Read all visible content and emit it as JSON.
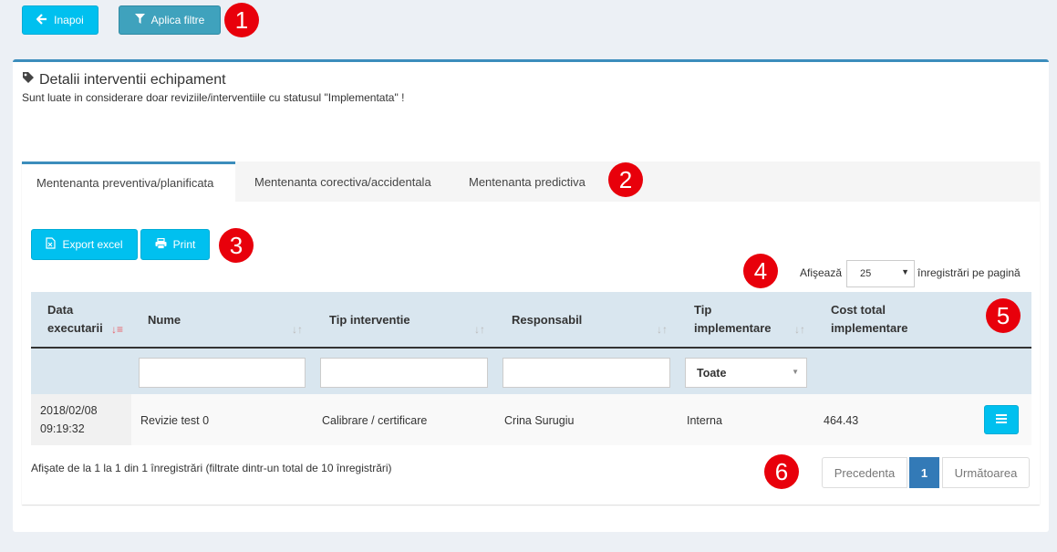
{
  "toolbar": {
    "back_label": "Inapoi",
    "filter_label": "Aplica filtre"
  },
  "markers": [
    "1",
    "2",
    "3",
    "4",
    "5",
    "6"
  ],
  "box": {
    "title": "Detalii interventii echipament",
    "subtitle": "Sunt luate in considerare doar reviziile/interventiile cu statusul \"Implementata\" !"
  },
  "tabs": [
    {
      "label": "Mentenanta preventiva/planificata",
      "active": true
    },
    {
      "label": "Mentenanta corectiva/accidentala",
      "active": false
    },
    {
      "label": "Mentenanta predictiva",
      "active": false
    }
  ],
  "actions": {
    "export_label": "Export excel",
    "print_label": "Print"
  },
  "length": {
    "prefix": "Afişează",
    "value": "25",
    "suffix": "înregistrări pe pagină"
  },
  "table": {
    "headers": [
      {
        "line1": "Data",
        "line2": "executarii"
      },
      {
        "line1": "Nume",
        "line2": ""
      },
      {
        "line1": "Tip interventie",
        "line2": ""
      },
      {
        "line1": "Responsabil",
        "line2": ""
      },
      {
        "line1": "Tip",
        "line2": "implementare"
      },
      {
        "line1": "Cost total",
        "line2": "implementare"
      }
    ],
    "filter_select": "Toate",
    "rows": [
      {
        "date": "2018/02/08",
        "time": "09:19:32",
        "name": "Revizie test 0",
        "type": "Calibrare / certificare",
        "responsible": "Crina Surugiu",
        "implementation": "Interna",
        "cost": "464.43"
      }
    ]
  },
  "info": "Afişate de la 1 la 1 din 1 înregistrări (filtrate dintr-un total de 10 înregistrări)",
  "pagination": {
    "prev": "Precedenta",
    "current": "1",
    "next": "Următoarea"
  },
  "colors": {
    "accent": "#3c8dbc",
    "button": "#00c0ef",
    "marker": "#e8000b",
    "header_bg": "#d9e6ef"
  }
}
